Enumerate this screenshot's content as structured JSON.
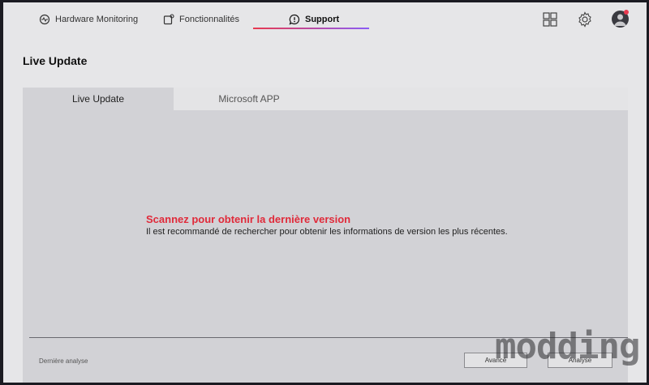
{
  "nav": {
    "tabs": [
      {
        "label": "Hardware Monitoring",
        "icon": "hardware-monitoring-icon"
      },
      {
        "label": "Fonctionnalités",
        "icon": "features-icon"
      },
      {
        "label": "Support",
        "icon": "support-icon",
        "active": true
      }
    ],
    "right_icons": [
      "grid-icon",
      "gear-icon",
      "avatar"
    ]
  },
  "page": {
    "title": "Live Update"
  },
  "tabs": [
    {
      "label": "Live Update",
      "active": true
    },
    {
      "label": "Microsoft APP",
      "active": false
    }
  ],
  "content": {
    "scan_title": "Scannez pour obtenir la dernière version",
    "scan_description": "Il est recommandé de rechercher pour obtenir les informations de version les plus récentes.",
    "last_scan_label": "Dernière analyse"
  },
  "buttons": {
    "advanced": "Avancé",
    "scan": "Analyse"
  },
  "watermark": "modding.fr",
  "colors": {
    "accent": "#e02a3a",
    "underline_start": "#e8394f",
    "underline_end": "#8b5cf6",
    "background": "#e6e6e8"
  }
}
